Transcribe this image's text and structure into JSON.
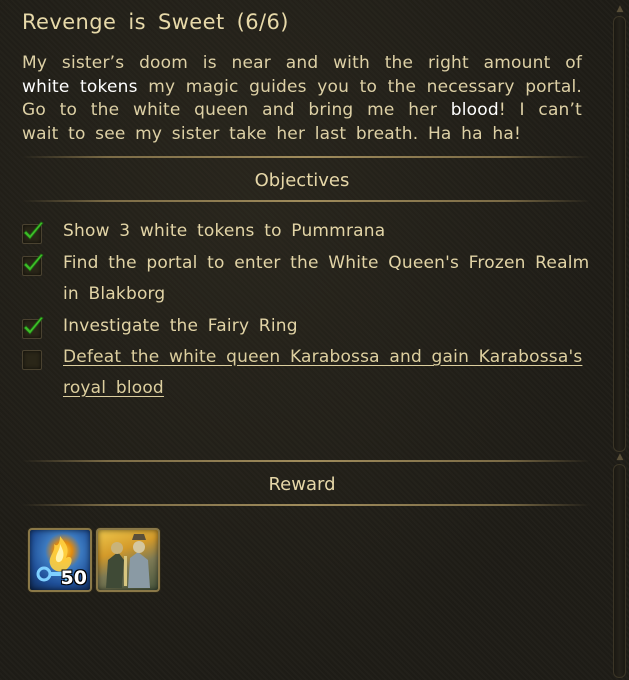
{
  "quest": {
    "title": "Revenge is Sweet (6/6)",
    "description": {
      "part1": "My sister’s doom is near and with the right amount of ",
      "highlight1": "white tokens",
      "part2": " my magic guides you to the necessary portal. Go to the white queen and bring me her ",
      "highlight2": "blood",
      "part3": "! I can’t wait to see my sister take her last breath. Ha ha ha!"
    }
  },
  "objectives": {
    "heading": "Objectives",
    "items": [
      {
        "text": "Show 3 white tokens to Pummrana",
        "completed": true
      },
      {
        "text": "Find the portal to enter the White Queen's Frozen Realm in Blakborg",
        "completed": true
      },
      {
        "text": "Investigate the Fairy Ring",
        "completed": true
      },
      {
        "text": "Defeat the white queen Karabossa and gain Karabossa's royal blood",
        "completed": false
      }
    ]
  },
  "reward": {
    "heading": "Reward",
    "items": [
      {
        "icon": "blue-flame-key-icon",
        "quantity": "50"
      },
      {
        "icon": "hero-portrait-icon",
        "quantity": ""
      }
    ]
  },
  "colors": {
    "background": "#1e1c16",
    "text": "#e6d7a8",
    "highlight": "#ffffff",
    "check": "#3fbf2a"
  }
}
